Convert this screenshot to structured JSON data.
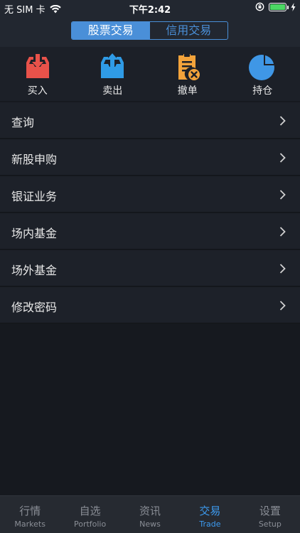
{
  "status": {
    "carrier": "无 SIM 卡",
    "time": "下午2:42",
    "battery_color": "#4cd964"
  },
  "header": {
    "tabs": [
      {
        "label": "股票交易",
        "active": true
      },
      {
        "label": "信用交易",
        "active": false
      }
    ],
    "accent": "#4a8fd8"
  },
  "actions": [
    {
      "label": "买入",
      "icon": "buy-inbox-icon",
      "color": "#e8524a"
    },
    {
      "label": "卖出",
      "icon": "sell-upload-icon",
      "color": "#2f9be6"
    },
    {
      "label": "撤单",
      "icon": "cancel-order-clipboard-icon",
      "color": "#f3a33b"
    },
    {
      "label": "持仓",
      "icon": "position-pie-icon",
      "color": "#3f97e6"
    }
  ],
  "menu": [
    {
      "label": "查询"
    },
    {
      "label": "新股申购"
    },
    {
      "label": "银证业务"
    },
    {
      "label": "场内基金"
    },
    {
      "label": "场外基金"
    },
    {
      "label": "修改密码"
    }
  ],
  "tabbar": [
    {
      "cn": "行情",
      "en": "Markets",
      "icon": "markets-icon"
    },
    {
      "cn": "自选",
      "en": "Portfolio",
      "icon": "portfolio-icon"
    },
    {
      "cn": "资讯",
      "en": "News",
      "icon": "news-icon"
    },
    {
      "cn": "交易",
      "en": "Trade",
      "icon": "trade-icon",
      "active": true
    },
    {
      "cn": "设置",
      "en": "Setup",
      "icon": "setup-icon"
    }
  ]
}
